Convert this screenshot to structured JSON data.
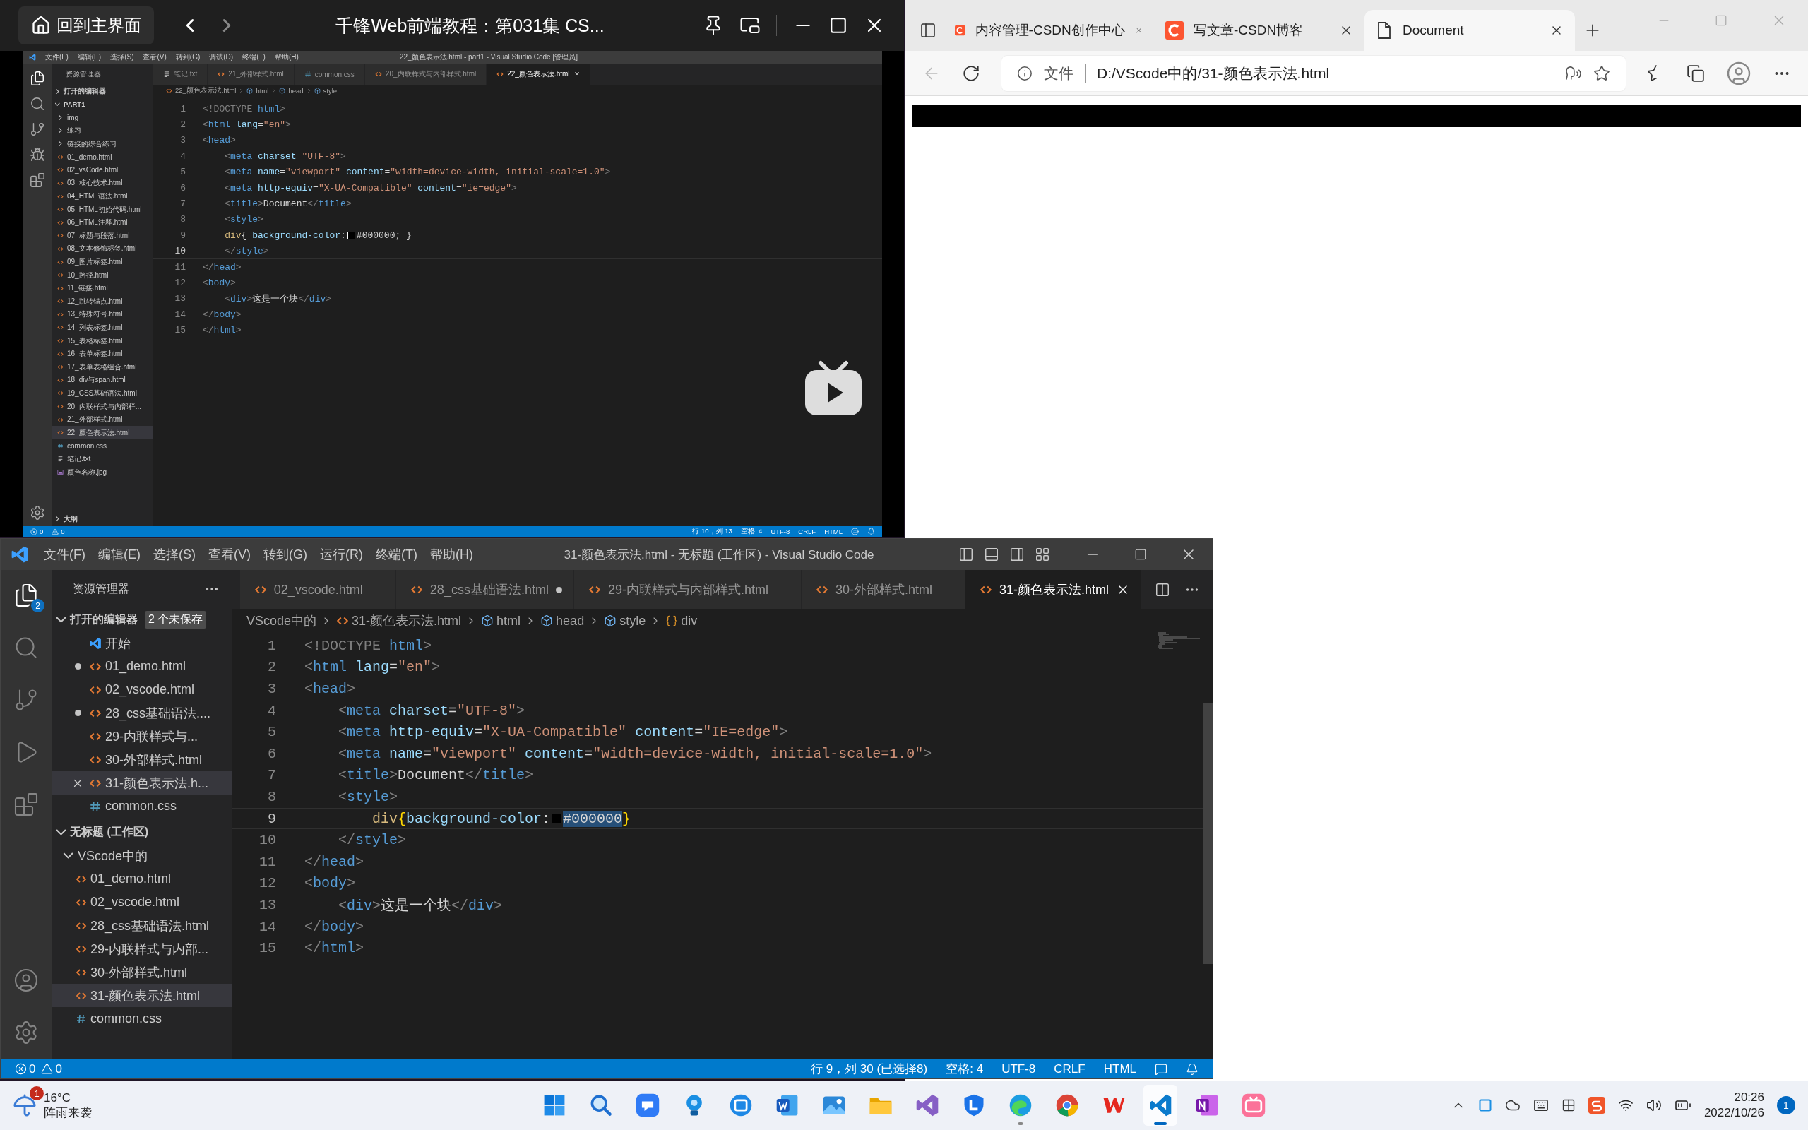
{
  "video_window": {
    "home_button": "回到主界面",
    "title": "千锋Web前端教程：第031集 CS...",
    "vscode": {
      "menu": [
        "文件(F)",
        "编辑(E)",
        "选择(S)",
        "查看(V)",
        "转到(G)",
        "调试(D)",
        "终端(T)",
        "帮助(H)"
      ],
      "title": "22_颜色表示法.html - part1 - Visual Studio Code [管理员]",
      "explorer_title": "资源管理器",
      "sections": [
        {
          "label": "打开的编辑器",
          "expanded": false
        },
        {
          "label": "PART1",
          "expanded": true,
          "children": [
            {
              "label": "img",
              "kind": "folder",
              "expanded": false,
              "selected": false
            },
            {
              "label": "练习",
              "kind": "folder",
              "expanded": false,
              "selected": false
            },
            {
              "label": "链接的综合练习",
              "kind": "folder",
              "expanded": false,
              "selected": false
            },
            {
              "label": "01_demo.html",
              "kind": "html",
              "selected": false
            },
            {
              "label": "02_vsCode.html",
              "kind": "html",
              "selected": false
            },
            {
              "label": "03_核心技术.html",
              "kind": "html",
              "selected": false
            },
            {
              "label": "04_HTML语法.html",
              "kind": "html",
              "selected": false
            },
            {
              "label": "05_HTML初始代码.html",
              "kind": "html",
              "selected": false
            },
            {
              "label": "06_HTML注释.html",
              "kind": "html",
              "selected": false
            },
            {
              "label": "07_标题与段落.html",
              "kind": "html",
              "selected": false
            },
            {
              "label": "08_文本修饰标签.html",
              "kind": "html",
              "selected": false
            },
            {
              "label": "09_图片标签.html",
              "kind": "html",
              "selected": false
            },
            {
              "label": "10_路径.html",
              "kind": "html",
              "selected": false
            },
            {
              "label": "11_链接.html",
              "kind": "html",
              "selected": false
            },
            {
              "label": "12_跳转锚点.html",
              "kind": "html",
              "selected": false
            },
            {
              "label": "13_特殊符号.html",
              "kind": "html",
              "selected": false
            },
            {
              "label": "14_列表标签.html",
              "kind": "html",
              "selected": false
            },
            {
              "label": "15_表格标签.html",
              "kind": "html",
              "selected": false
            },
            {
              "label": "16_表单标签.html",
              "kind": "html",
              "selected": false
            },
            {
              "label": "17_表单表格组合.html",
              "kind": "html",
              "selected": false
            },
            {
              "label": "18_div与span.html",
              "kind": "html",
              "selected": false
            },
            {
              "label": "19_CSS基础语法.html",
              "kind": "html",
              "selected": false
            },
            {
              "label": "20_内联样式与内部样...",
              "kind": "html",
              "selected": false
            },
            {
              "label": "21_外部样式.html",
              "kind": "html",
              "selected": false
            },
            {
              "label": "22_颜色表示法.html",
              "kind": "html",
              "selected": true
            },
            {
              "label": "common.css",
              "kind": "css",
              "selected": false
            },
            {
              "label": "笔记.txt",
              "kind": "txt",
              "selected": false
            },
            {
              "label": "颜色名称.jpg",
              "kind": "image",
              "selected": false
            }
          ]
        }
      ],
      "outline": {
        "label": "大纲",
        "expanded": false
      },
      "tabs": [
        {
          "label": "笔记.txt",
          "kind": "txt",
          "selected": false
        },
        {
          "label": "21_外部样式.html",
          "kind": "html",
          "selected": false
        },
        {
          "label": "common.css",
          "kind": "css",
          "selected": false
        },
        {
          "label": "20_内联样式与内部样式.html",
          "kind": "html",
          "selected": false
        },
        {
          "label": "22_颜色表示法.html",
          "kind": "html",
          "selected": true
        }
      ],
      "breadcrumb": [
        {
          "label": "22_颜色表示法.html",
          "kind": "html"
        },
        {
          "label": "html",
          "kind": "element"
        },
        {
          "label": "head",
          "kind": "element"
        },
        {
          "label": "style",
          "kind": "element"
        }
      ],
      "lines": [
        {
          "number": "1",
          "current": false,
          "tokens": [
            {
              "kind": "p",
              "text": "<!DOCTYPE "
            },
            {
              "kind": "tag",
              "text": "html"
            },
            {
              "kind": "p",
              "text": ">"
            }
          ]
        },
        {
          "number": "2",
          "current": false,
          "tokens": [
            {
              "kind": "p",
              "text": "<"
            },
            {
              "kind": "tag",
              "text": "html"
            },
            {
              "kind": "attr",
              "text": " lang"
            },
            {
              "kind": "txt",
              "text": "="
            },
            {
              "kind": "str",
              "text": "\"en\""
            },
            {
              "kind": "p",
              "text": ">"
            }
          ]
        },
        {
          "number": "3",
          "current": false,
          "tokens": [
            {
              "kind": "p",
              "text": "<"
            },
            {
              "kind": "tag",
              "text": "head"
            },
            {
              "kind": "p",
              "text": ">"
            }
          ]
        },
        {
          "number": "4",
          "current": false,
          "tokens": [
            {
              "kind": "p",
              "text": "    <"
            },
            {
              "kind": "tag",
              "text": "meta"
            },
            {
              "kind": "attr",
              "text": " charset"
            },
            {
              "kind": "txt",
              "text": "="
            },
            {
              "kind": "str",
              "text": "\"UTF-8\""
            },
            {
              "kind": "p",
              "text": ">"
            }
          ]
        },
        {
          "number": "5",
          "current": false,
          "tokens": [
            {
              "kind": "p",
              "text": "    <"
            },
            {
              "kind": "tag",
              "text": "meta"
            },
            {
              "kind": "attr",
              "text": " name"
            },
            {
              "kind": "txt",
              "text": "="
            },
            {
              "kind": "str",
              "text": "\"viewport\""
            },
            {
              "kind": "attr",
              "text": " content"
            },
            {
              "kind": "txt",
              "text": "="
            },
            {
              "kind": "str",
              "text": "\"width=device-width, initial-scale=1.0\""
            },
            {
              "kind": "p",
              "text": ">"
            }
          ]
        },
        {
          "number": "6",
          "current": false,
          "tokens": [
            {
              "kind": "p",
              "text": "    <"
            },
            {
              "kind": "tag",
              "text": "meta"
            },
            {
              "kind": "attr",
              "text": " http-equiv"
            },
            {
              "kind": "txt",
              "text": "="
            },
            {
              "kind": "str",
              "text": "\"X-UA-Compatible\""
            },
            {
              "kind": "attr",
              "text": " content"
            },
            {
              "kind": "txt",
              "text": "="
            },
            {
              "kind": "str",
              "text": "\"ie=edge\""
            },
            {
              "kind": "p",
              "text": ">"
            }
          ]
        },
        {
          "number": "7",
          "current": false,
          "tokens": [
            {
              "kind": "p",
              "text": "    <"
            },
            {
              "kind": "tag",
              "text": "title"
            },
            {
              "kind": "p",
              "text": ">"
            },
            {
              "kind": "txt",
              "text": "Document"
            },
            {
              "kind": "p",
              "text": "</"
            },
            {
              "kind": "tag",
              "text": "title"
            },
            {
              "kind": "p",
              "text": ">"
            }
          ]
        },
        {
          "number": "8",
          "current": false,
          "tokens": [
            {
              "kind": "p",
              "text": "    <"
            },
            {
              "kind": "tag",
              "text": "style"
            },
            {
              "kind": "p",
              "text": ">"
            }
          ]
        },
        {
          "number": "9",
          "current": false,
          "tokens": [
            {
              "kind": "sel",
              "text": "    div"
            },
            {
              "kind": "txt",
              "text": "{ "
            },
            {
              "kind": "prop",
              "text": "background-color"
            },
            {
              "kind": "txt",
              "text": ":"
            },
            {
              "kind": "swatch",
              "color": "#000000"
            },
            {
              "kind": "txt",
              "text": "#000000; }"
            }
          ]
        },
        {
          "number": "10",
          "current": true,
          "tokens": [
            {
              "kind": "p",
              "text": "    </"
            },
            {
              "kind": "tag",
              "text": "style"
            },
            {
              "kind": "p",
              "text": ">"
            }
          ]
        },
        {
          "number": "11",
          "current": false,
          "tokens": [
            {
              "kind": "p",
              "text": "</"
            },
            {
              "kind": "tag",
              "text": "head"
            },
            {
              "kind": "p",
              "text": ">"
            }
          ]
        },
        {
          "number": "12",
          "current": false,
          "tokens": [
            {
              "kind": "p",
              "text": "<"
            },
            {
              "kind": "tag",
              "text": "body"
            },
            {
              "kind": "p",
              "text": ">"
            }
          ]
        },
        {
          "number": "13",
          "current": false,
          "tokens": [
            {
              "kind": "p",
              "text": "    <"
            },
            {
              "kind": "tag",
              "text": "div"
            },
            {
              "kind": "p",
              "text": ">"
            },
            {
              "kind": "txt",
              "text": "这是一个块"
            },
            {
              "kind": "p",
              "text": "</"
            },
            {
              "kind": "tag",
              "text": "div"
            },
            {
              "kind": "p",
              "text": ">"
            }
          ]
        },
        {
          "number": "14",
          "current": false,
          "tokens": [
            {
              "kind": "p",
              "text": "</"
            },
            {
              "kind": "tag",
              "text": "body"
            },
            {
              "kind": "p",
              "text": ">"
            }
          ]
        },
        {
          "number": "15",
          "current": false,
          "tokens": [
            {
              "kind": "p",
              "text": "</"
            },
            {
              "kind": "tag",
              "text": "html"
            },
            {
              "kind": "p",
              "text": ">"
            }
          ]
        }
      ],
      "status": {
        "errors": "0",
        "warnings": "0",
        "items": [
          "行 10，列 13",
          "空格: 4",
          "UTF-8",
          "CRLF",
          "HTML"
        ]
      }
    }
  },
  "vscode_window": {
    "menu": [
      "文件(F)",
      "编辑(E)",
      "选择(S)",
      "查看(V)",
      "转到(G)",
      "运行(R)",
      "终端(T)",
      "帮助(H)"
    ],
    "title": "31-颜色表示法.html - 无标题 (工作区) - Visual Studio Code",
    "explorer_badge": "2",
    "explorer_title": "资源管理器",
    "open_editors": {
      "label": "打开的编辑器",
      "badge": "2 个未保存",
      "expanded": true,
      "items": [
        {
          "label": "开始",
          "kind": "welcome",
          "dirty": false,
          "selected": false
        },
        {
          "label": "01_demo.html",
          "kind": "html",
          "dirty": true,
          "selected": false
        },
        {
          "label": "02_vscode.html",
          "kind": "html",
          "dirty": false,
          "selected": false
        },
        {
          "label": "28_css基础语法....",
          "kind": "html",
          "dirty": true,
          "selected": false
        },
        {
          "label": "29-内联样式与...",
          "kind": "html",
          "dirty": false,
          "selected": false
        },
        {
          "label": "30-外部样式.html",
          "kind": "html",
          "dirty": false,
          "selected": false
        },
        {
          "label": "31-颜色表示法.h...",
          "kind": "html",
          "dirty": false,
          "selected": true
        },
        {
          "label": "common.css",
          "kind": "css",
          "dirty": false,
          "selected": false
        }
      ]
    },
    "workspace": {
      "label": "无标题 (工作区)",
      "expanded": true,
      "children": [
        {
          "label": "VScode中的",
          "kind": "folder",
          "expanded": true,
          "selected": false,
          "children": [
            {
              "label": "01_demo.html",
              "kind": "html",
              "selected": false
            },
            {
              "label": "02_vscode.html",
              "kind": "html",
              "selected": false
            },
            {
              "label": "28_css基础语法.html",
              "kind": "html",
              "selected": false
            },
            {
              "label": "29-内联样式与内部...",
              "kind": "html",
              "selected": false
            },
            {
              "label": "30-外部样式.html",
              "kind": "html",
              "selected": false
            },
            {
              "label": "31-颜色表示法.html",
              "kind": "html",
              "selected": true
            },
            {
              "label": "common.css",
              "kind": "css",
              "selected": false
            }
          ]
        }
      ]
    },
    "tabs": [
      {
        "label": "02_vscode.html",
        "kind": "html",
        "dirty": false,
        "selected": false
      },
      {
        "label": "28_css基础语法.html",
        "kind": "html",
        "dirty": true,
        "selected": false
      },
      {
        "label": "29-内联样式与内部样式.html",
        "kind": "html",
        "dirty": false,
        "selected": false
      },
      {
        "label": "30-外部样式.html",
        "kind": "html",
        "dirty": false,
        "selected": false
      },
      {
        "label": "31-颜色表示法.html",
        "kind": "html",
        "dirty": false,
        "selected": true
      }
    ],
    "breadcrumb": [
      {
        "label": "VScode中的",
        "kind": "folder"
      },
      {
        "label": "31-颜色表示法.html",
        "kind": "html"
      },
      {
        "label": "html",
        "kind": "element"
      },
      {
        "label": "head",
        "kind": "element"
      },
      {
        "label": "style",
        "kind": "element"
      },
      {
        "label": "div",
        "kind": "selector"
      }
    ],
    "lines": [
      {
        "number": "1",
        "current": false,
        "tokens": [
          {
            "kind": "p",
            "text": "<!DOCTYPE "
          },
          {
            "kind": "tag",
            "text": "html"
          },
          {
            "kind": "p",
            "text": ">"
          }
        ]
      },
      {
        "number": "2",
        "current": false,
        "tokens": [
          {
            "kind": "p",
            "text": "<"
          },
          {
            "kind": "tag",
            "text": "html"
          },
          {
            "kind": "attr",
            "text": " lang"
          },
          {
            "kind": "txt",
            "text": "="
          },
          {
            "kind": "str",
            "text": "\"en\""
          },
          {
            "kind": "p",
            "text": ">"
          }
        ]
      },
      {
        "number": "3",
        "current": false,
        "tokens": [
          {
            "kind": "p",
            "text": "<"
          },
          {
            "kind": "tag",
            "text": "head"
          },
          {
            "kind": "p",
            "text": ">"
          }
        ]
      },
      {
        "number": "4",
        "current": false,
        "tokens": [
          {
            "kind": "p",
            "text": "    <"
          },
          {
            "kind": "tag",
            "text": "meta"
          },
          {
            "kind": "attr",
            "text": " charset"
          },
          {
            "kind": "txt",
            "text": "="
          },
          {
            "kind": "str",
            "text": "\"UTF-8\""
          },
          {
            "kind": "p",
            "text": ">"
          }
        ]
      },
      {
        "number": "5",
        "current": false,
        "tokens": [
          {
            "kind": "p",
            "text": "    <"
          },
          {
            "kind": "tag",
            "text": "meta"
          },
          {
            "kind": "attr",
            "text": " http-equiv"
          },
          {
            "kind": "txt",
            "text": "="
          },
          {
            "kind": "str",
            "text": "\"X-UA-Compatible\""
          },
          {
            "kind": "attr",
            "text": " content"
          },
          {
            "kind": "txt",
            "text": "="
          },
          {
            "kind": "str",
            "text": "\"IE=edge\""
          },
          {
            "kind": "p",
            "text": ">"
          }
        ]
      },
      {
        "number": "6",
        "current": false,
        "tokens": [
          {
            "kind": "p",
            "text": "    <"
          },
          {
            "kind": "tag",
            "text": "meta"
          },
          {
            "kind": "attr",
            "text": " name"
          },
          {
            "kind": "txt",
            "text": "="
          },
          {
            "kind": "str",
            "text": "\"viewport\""
          },
          {
            "kind": "attr",
            "text": " content"
          },
          {
            "kind": "txt",
            "text": "="
          },
          {
            "kind": "str",
            "text": "\"width=device-width, initial-scale=1.0\""
          },
          {
            "kind": "p",
            "text": ">"
          }
        ]
      },
      {
        "number": "7",
        "current": false,
        "tokens": [
          {
            "kind": "p",
            "text": "    <"
          },
          {
            "kind": "tag",
            "text": "title"
          },
          {
            "kind": "p",
            "text": ">"
          },
          {
            "kind": "txt",
            "text": "Document"
          },
          {
            "kind": "p",
            "text": "</"
          },
          {
            "kind": "tag",
            "text": "title"
          },
          {
            "kind": "p",
            "text": ">"
          }
        ]
      },
      {
        "number": "8",
        "current": false,
        "tokens": [
          {
            "kind": "p",
            "text": "    <"
          },
          {
            "kind": "tag",
            "text": "style"
          },
          {
            "kind": "p",
            "text": ">"
          }
        ]
      },
      {
        "number": "9",
        "current": true,
        "tokens": [
          {
            "kind": "sel",
            "text": "        div"
          },
          {
            "kind": "brace",
            "text": "{"
          },
          {
            "kind": "prop",
            "text": "background-color"
          },
          {
            "kind": "txt",
            "text": ":"
          },
          {
            "kind": "swatch",
            "color": "#000000"
          },
          {
            "kind": "selection",
            "text": "#000000"
          },
          {
            "kind": "brace",
            "text": "}"
          }
        ]
      },
      {
        "number": "10",
        "current": false,
        "tokens": [
          {
            "kind": "p",
            "text": "    </"
          },
          {
            "kind": "tag",
            "text": "style"
          },
          {
            "kind": "p",
            "text": ">"
          }
        ]
      },
      {
        "number": "11",
        "current": false,
        "tokens": [
          {
            "kind": "p",
            "text": "</"
          },
          {
            "kind": "tag",
            "text": "head"
          },
          {
            "kind": "p",
            "text": ">"
          }
        ]
      },
      {
        "number": "12",
        "current": false,
        "tokens": [
          {
            "kind": "p",
            "text": "<"
          },
          {
            "kind": "tag",
            "text": "body"
          },
          {
            "kind": "p",
            "text": ">"
          }
        ]
      },
      {
        "number": "13",
        "current": false,
        "tokens": [
          {
            "kind": "p",
            "text": "    <"
          },
          {
            "kind": "tag",
            "text": "div"
          },
          {
            "kind": "p",
            "text": ">"
          },
          {
            "kind": "txt",
            "text": "这是一个块"
          },
          {
            "kind": "p",
            "text": "</"
          },
          {
            "kind": "tag",
            "text": "div"
          },
          {
            "kind": "p",
            "text": ">"
          }
        ]
      },
      {
        "number": "14",
        "current": false,
        "tokens": [
          {
            "kind": "p",
            "text": "</"
          },
          {
            "kind": "tag",
            "text": "body"
          },
          {
            "kind": "p",
            "text": ">"
          }
        ]
      },
      {
        "number": "15",
        "current": false,
        "tokens": [
          {
            "kind": "p",
            "text": "</"
          },
          {
            "kind": "tag",
            "text": "html"
          },
          {
            "kind": "p",
            "text": ">"
          }
        ]
      }
    ],
    "status": {
      "errors": "0",
      "warnings": "0",
      "items": [
        "行 9，列 30 (已选择8)",
        "空格: 4",
        "UTF-8",
        "CRLF",
        "HTML"
      ]
    }
  },
  "browser": {
    "tabs": [
      {
        "label": "内容管理-CSDN创作中心",
        "kind": "site",
        "selected": false
      },
      {
        "label": "写文章-CSDN博客",
        "kind": "site",
        "selected": false
      },
      {
        "label": "Document",
        "kind": "page",
        "selected": true
      }
    ],
    "address": {
      "scheme_label": "文件",
      "url": "D:/VScode中的/31-颜色表示法.html"
    }
  },
  "taskbar": {
    "weather": {
      "badge": "1",
      "temperature": "16°C",
      "condition": "阵雨来袭"
    },
    "apps": [
      {
        "kind": "start",
        "running": false,
        "selected": false
      },
      {
        "kind": "search",
        "running": false,
        "selected": false
      },
      {
        "kind": "chat",
        "running": false,
        "selected": false
      },
      {
        "kind": "bulb",
        "running": false,
        "selected": false
      },
      {
        "kind": "capture",
        "running": false,
        "selected": false
      },
      {
        "kind": "word",
        "running": false,
        "selected": false
      },
      {
        "kind": "photos",
        "running": false,
        "selected": false
      },
      {
        "kind": "folder",
        "running": false,
        "selected": false
      },
      {
        "kind": "studio",
        "running": false,
        "selected": false
      },
      {
        "kind": "shield",
        "running": false,
        "selected": false
      },
      {
        "kind": "edge",
        "running": true,
        "selected": false
      },
      {
        "kind": "chrome",
        "running": false,
        "selected": false
      },
      {
        "kind": "wps",
        "running": false,
        "selected": false
      },
      {
        "kind": "code",
        "running": true,
        "selected": true
      },
      {
        "kind": "onenote",
        "running": false,
        "selected": false
      },
      {
        "kind": "bili",
        "running": false,
        "selected": false
      }
    ],
    "clock": {
      "time": "20:26",
      "date": "2022/10/26"
    },
    "notifications": "1"
  }
}
